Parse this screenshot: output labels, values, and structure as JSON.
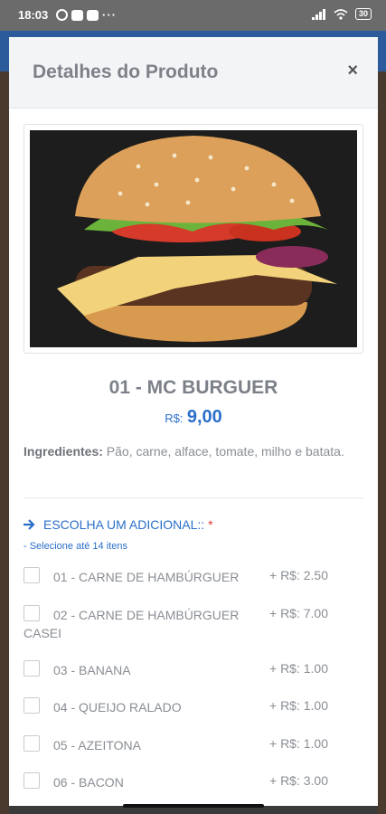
{
  "status_bar": {
    "time": "18:03",
    "dots": "···",
    "battery": "30"
  },
  "modal": {
    "title": "Detalhes do Produto",
    "close": "×"
  },
  "product": {
    "name": "01 - MC BURGUER",
    "currency": "R$:",
    "price": "9,00",
    "ingredients_label": "Ingredientes:",
    "ingredients_text": "Pão, carne, alface, tomate, milho e batata."
  },
  "addons": {
    "title": "ESCOLHA UM ADICIONAL::",
    "required_mark": "*",
    "subtitle": "- Selecione até 14 itens",
    "items": [
      {
        "label": "01 - CARNE DE HAMBÚRGUER",
        "price": "+ R$: 2.50"
      },
      {
        "label": "02 - CARNE DE HAMBÚRGUER CASEI",
        "price": "+ R$: 7.00"
      },
      {
        "label": "03 - BANANA",
        "price": "+ R$: 1.00"
      },
      {
        "label": "04 - QUEIJO RALADO",
        "price": "+ R$: 1.00"
      },
      {
        "label": "05 - AZEITONA",
        "price": "+ R$: 1.00"
      },
      {
        "label": "06 - BACON",
        "price": "+ R$: 3.00"
      }
    ]
  },
  "colors": {
    "accent": "#2a6fc9",
    "required": "#d93838",
    "header_bg": "#f3f4f6"
  }
}
